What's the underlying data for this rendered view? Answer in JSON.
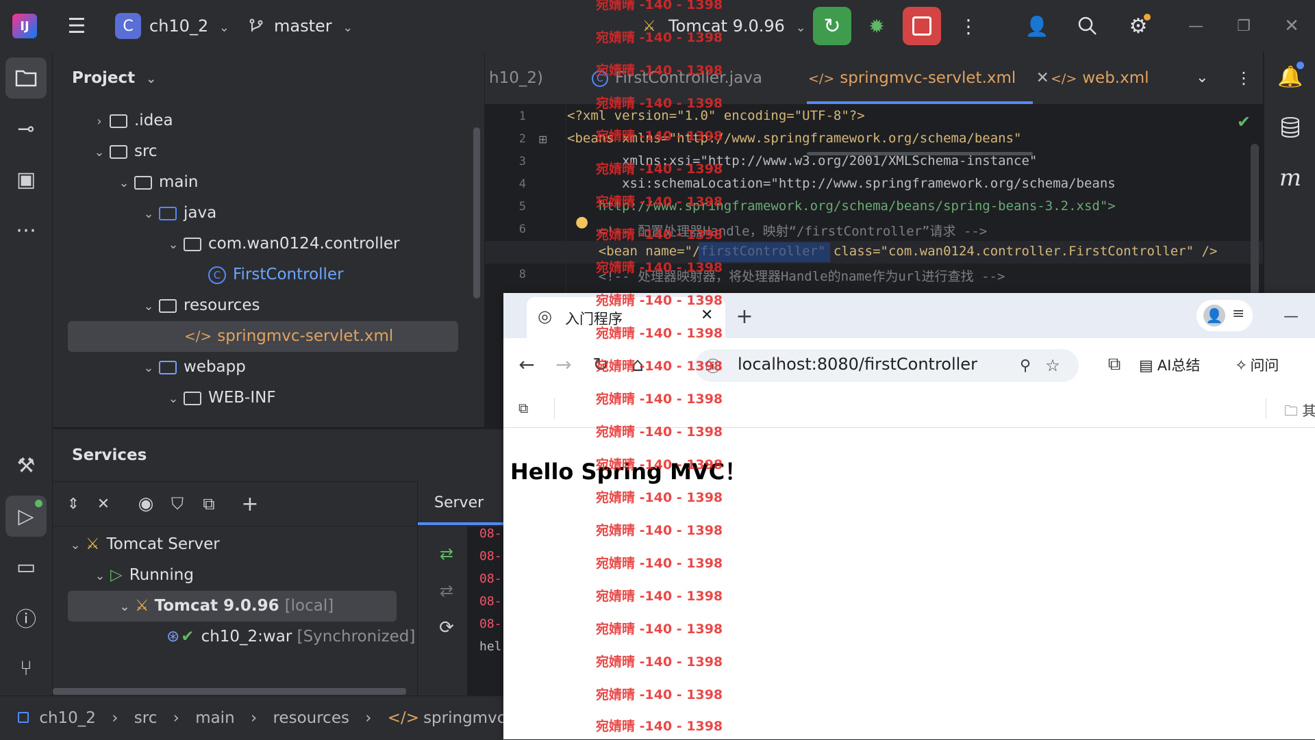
{
  "topbar": {
    "project_initial": "C",
    "project_name": "ch10_2",
    "branch": "master",
    "run_config": "Tomcat 9.0.96"
  },
  "project_panel": {
    "title": "Project",
    "tree": [
      {
        "label": ".idea",
        "depth": 1,
        "chev": "›",
        "type": "folder"
      },
      {
        "label": "src",
        "depth": 1,
        "chev": "⌄",
        "type": "folder"
      },
      {
        "label": "main",
        "depth": 2,
        "chev": "⌄",
        "type": "folder"
      },
      {
        "label": "java",
        "depth": 3,
        "chev": "⌄",
        "type": "folder-blue"
      },
      {
        "label": "com.wan0124.controller",
        "depth": 4,
        "chev": "⌄",
        "type": "package"
      },
      {
        "label": "FirstController",
        "depth": 5,
        "chev": "",
        "type": "class"
      },
      {
        "label": "resources",
        "depth": 3,
        "chev": "⌄",
        "type": "folder-res"
      },
      {
        "label": "springmvc-servlet.xml",
        "depth": 4,
        "chev": "",
        "type": "xml"
      },
      {
        "label": "webapp",
        "depth": 3,
        "chev": "⌄",
        "type": "folder-web"
      },
      {
        "label": "WEB-INF",
        "depth": 4,
        "chev": "⌄",
        "type": "folder"
      }
    ]
  },
  "editor": {
    "tabs": [
      {
        "label": "h10_2)"
      },
      {
        "label": "FirstController.java"
      },
      {
        "label": "springmvc-servlet.xml"
      },
      {
        "label": "web.xml"
      }
    ],
    "lines": [
      {
        "n": "1",
        "text": "<?xml version=\"1.0\" encoding=\"UTF-8\"?>"
      },
      {
        "n": "2",
        "text": "<beans xmlns=\"http://www.springframework.org/schema/beans\""
      },
      {
        "n": "3",
        "text": "       xmlns:xsi=\"http://www.w3.org/2001/XMLSchema-instance\""
      },
      {
        "n": "4",
        "text": "       xsi:schemaLocation=\"http://www.springframework.org/schema/beans"
      },
      {
        "n": "5",
        "text": "    http://www.springframework.org/schema/beans/spring-beans-3.2.xsd\">"
      },
      {
        "n": "6",
        "text": "    <!-- 配置处理器Handle，映射“/firstController”请求 -->"
      },
      {
        "n": "7",
        "text": "    <bean name=\"/firstController\" class=\"com.wan0124.controller.FirstController\" />"
      },
      {
        "n": "8",
        "text": "    <!-- 处理器映射器，将处理器Handle的name作为url进行查找 -->"
      }
    ]
  },
  "services": {
    "title": "Services",
    "server_tab": "Server",
    "tree": [
      {
        "label": "Tomcat Server",
        "extra": ""
      },
      {
        "label": "Running",
        "extra": ""
      },
      {
        "label": "Tomcat 9.0.96",
        "extra": "[local]"
      },
      {
        "label": "ch10_2:war",
        "extra": "[Synchronized]"
      }
    ],
    "log_lines": [
      "08-",
      "08-",
      "08-",
      "08-",
      "08-",
      "hel"
    ]
  },
  "statusbar": {
    "crumbs": [
      "ch10_2",
      "src",
      "main",
      "resources",
      "springmvc-servlet.x"
    ]
  },
  "browser": {
    "tab_title": "入门程序",
    "url": "localhost:8080/firstController",
    "ai_summary": "AI总结",
    "ask": "问问",
    "bookmark_cut": "其",
    "page_heading": "Hello Spring MVC！"
  },
  "watermark": {
    "text": "宛婧晴 -140 - 1398"
  }
}
